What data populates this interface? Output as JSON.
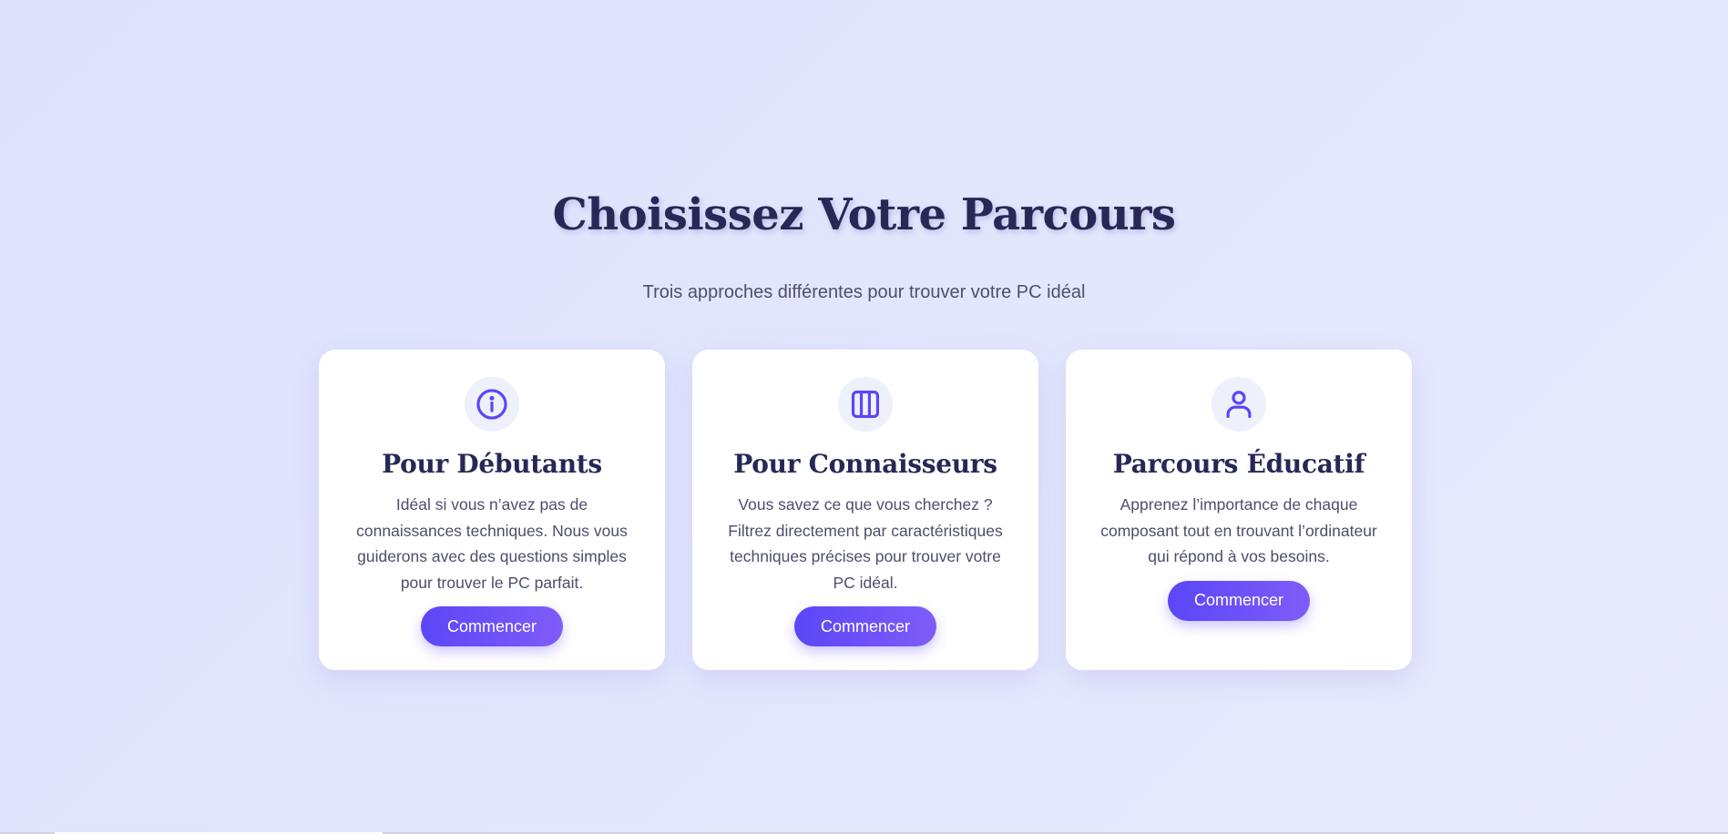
{
  "header": {
    "title": "Choisissez Votre Parcours",
    "subtitle": "Trois approches différentes pour trouver votre PC idéal"
  },
  "cards": [
    {
      "icon": "info-circle-icon",
      "title": "Pour Débutants",
      "description": "Idéal si vous n’avez pas de connaissances techniques. Nous vous guiderons avec des questions simples pour trouver le PC parfait.",
      "button_label": "Commencer"
    },
    {
      "icon": "columns-icon",
      "title": "Pour Connaisseurs",
      "description": "Vous savez ce que vous cherchez ? Filtrez directement par caractéristiques techniques précises pour trouver votre PC idéal.",
      "button_label": "Commencer"
    },
    {
      "icon": "user-icon",
      "title": "Parcours Éducatif",
      "description": "Apprenez l’importance de chaque composant tout en trouvant l’ordinateur qui répond à vos besoins.",
      "button_label": "Commencer"
    }
  ],
  "colors": {
    "accent": "#5b46f7",
    "accent_end": "#7f5cf8",
    "heading": "#272856",
    "body_text": "#4b4f6b",
    "icon_bg": "#eef0fc"
  }
}
